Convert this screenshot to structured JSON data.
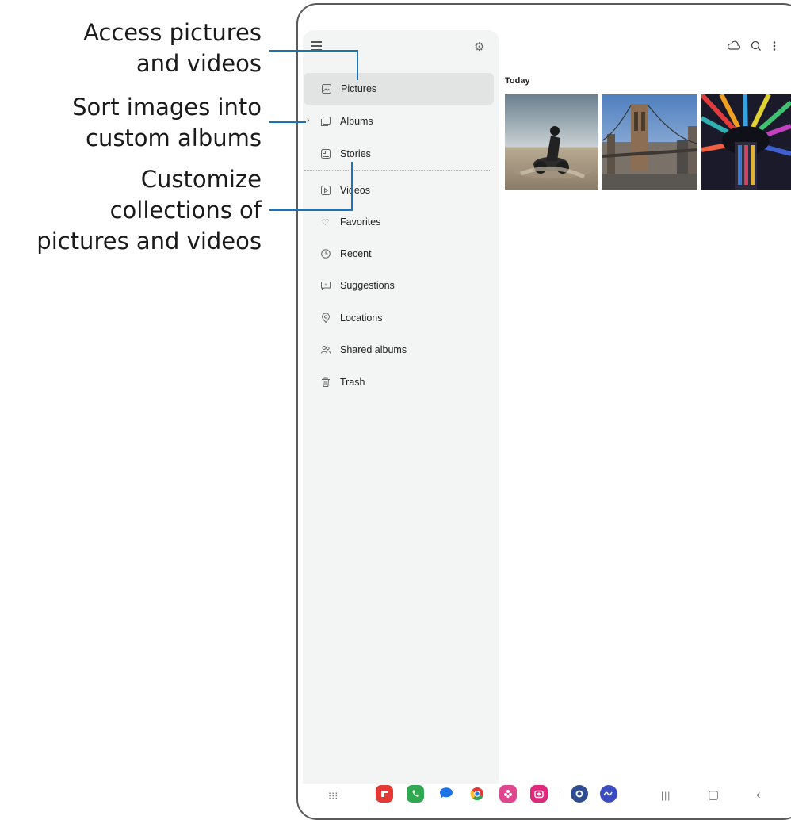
{
  "callouts": [
    {
      "lines": [
        "Access pictures",
        "and videos"
      ]
    },
    {
      "lines": [
        "Sort images into",
        "custom albums"
      ]
    },
    {
      "lines": [
        "Customize",
        "collections of",
        "pictures and videos"
      ]
    }
  ],
  "drawer": {
    "menu_icon": "hamburger-icon",
    "settings_icon": "gear-icon",
    "items": [
      {
        "label": "Pictures",
        "icon": "picture-icon",
        "active": true
      },
      {
        "label": "Albums",
        "icon": "albums-icon"
      },
      {
        "label": "Stories",
        "icon": "stories-icon"
      },
      {
        "label": "Videos",
        "icon": "video-icon"
      },
      {
        "label": "Favorites",
        "icon": "heart-icon"
      },
      {
        "label": "Recent",
        "icon": "clock-icon"
      },
      {
        "label": "Suggestions",
        "icon": "suggestions-icon"
      },
      {
        "label": "Locations",
        "icon": "location-icon"
      },
      {
        "label": "Shared albums",
        "icon": "shared-icon"
      },
      {
        "label": "Trash",
        "icon": "trash-icon"
      }
    ]
  },
  "toolbar": {
    "icons": [
      "cloud-icon",
      "search-icon",
      "more-icon"
    ]
  },
  "section": {
    "title": "Today"
  },
  "colors": {
    "accent": "#1a73b8",
    "drawer_bg": "#f3f4f4",
    "active_bg": "#e2e3e3"
  },
  "dock": {
    "apps": [
      "app-drawer-icon",
      "flipboard-icon",
      "phone-icon",
      "messages-icon",
      "chrome-icon",
      "bixby-icon",
      "camera-icon",
      "settings-icon",
      "pen-icon"
    ],
    "nav": [
      "recents-icon",
      "home-icon",
      "back-icon"
    ]
  }
}
